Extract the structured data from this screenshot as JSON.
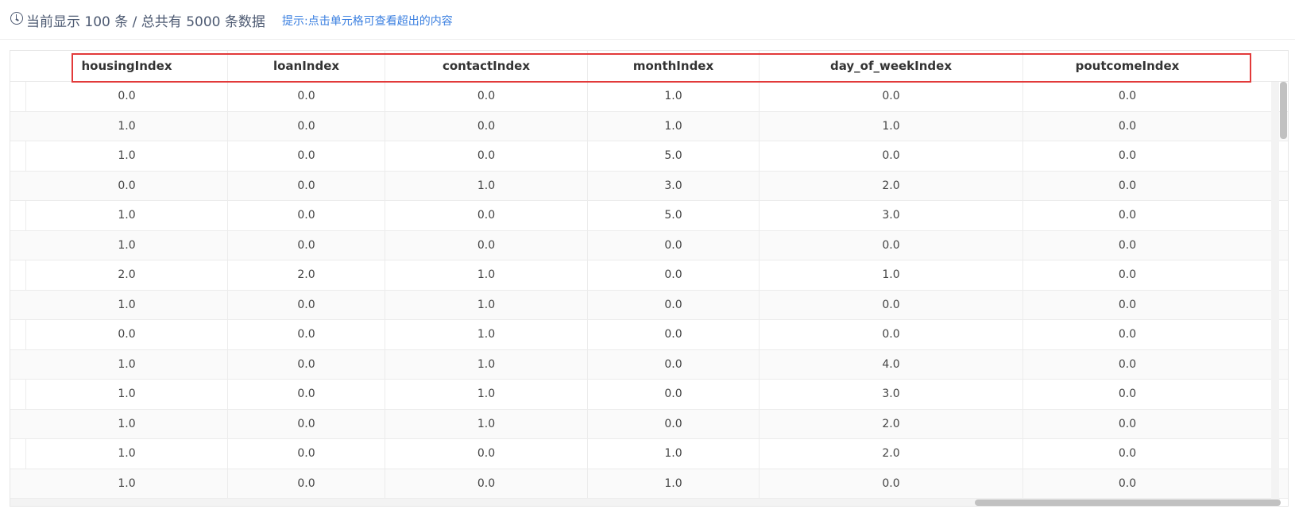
{
  "toolbar": {
    "count_text": "当前显示 100 条 / 总共有 5000 条数据",
    "hint_text": "提示:点击单元格可查看超出的内容"
  },
  "table": {
    "columns": [
      "housingIndex",
      "loanIndex",
      "contactIndex",
      "monthIndex",
      "day_of_weekIndex",
      "poutcomeIndex"
    ],
    "rows": [
      [
        "0.0",
        "0.0",
        "0.0",
        "1.0",
        "0.0",
        "0.0"
      ],
      [
        "1.0",
        "0.0",
        "0.0",
        "1.0",
        "1.0",
        "0.0"
      ],
      [
        "1.0",
        "0.0",
        "0.0",
        "5.0",
        "0.0",
        "0.0"
      ],
      [
        "0.0",
        "0.0",
        "1.0",
        "3.0",
        "2.0",
        "0.0"
      ],
      [
        "1.0",
        "0.0",
        "0.0",
        "5.0",
        "3.0",
        "0.0"
      ],
      [
        "1.0",
        "0.0",
        "0.0",
        "0.0",
        "0.0",
        "0.0"
      ],
      [
        "2.0",
        "2.0",
        "1.0",
        "0.0",
        "1.0",
        "0.0"
      ],
      [
        "1.0",
        "0.0",
        "1.0",
        "0.0",
        "0.0",
        "0.0"
      ],
      [
        "0.0",
        "0.0",
        "1.0",
        "0.0",
        "0.0",
        "0.0"
      ],
      [
        "1.0",
        "0.0",
        "1.0",
        "0.0",
        "4.0",
        "0.0"
      ],
      [
        "1.0",
        "0.0",
        "1.0",
        "0.0",
        "3.0",
        "0.0"
      ],
      [
        "1.0",
        "0.0",
        "1.0",
        "0.0",
        "2.0",
        "0.0"
      ],
      [
        "1.0",
        "0.0",
        "0.0",
        "1.0",
        "2.0",
        "0.0"
      ],
      [
        "1.0",
        "0.0",
        "0.0",
        "1.0",
        "0.0",
        "0.0"
      ]
    ]
  },
  "colors": {
    "highlight_border": "#e23a3a",
    "hint_blue": "#3a7fe0"
  }
}
